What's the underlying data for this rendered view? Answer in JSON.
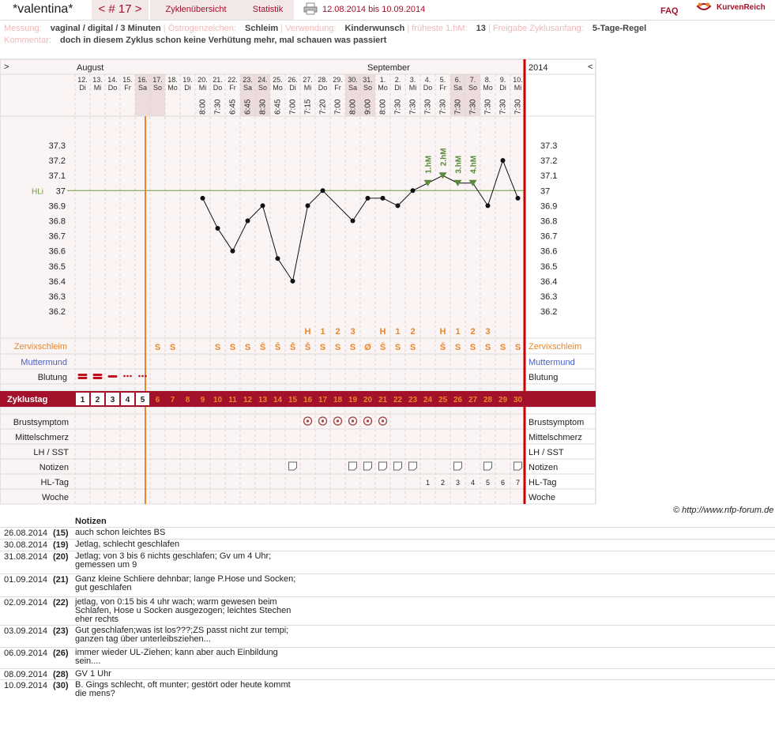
{
  "header": {
    "user": "*valentina*",
    "cycle": "< # 17 >",
    "overview": "Zyklenübersicht",
    "stats": "Statistik",
    "dates": "12.08.2014 bis 10.09.2014",
    "faq": "FAQ",
    "logo": "KurvenReich"
  },
  "info": {
    "messung_k": "Messung:",
    "messung_v": "vaginal / digital / 3 Minuten",
    "oestro_k": "Östrogenzeichen:",
    "oestro_v": "Schleim",
    "verw_k": "Verwendung:",
    "verw_v": "Kinderwunsch",
    "frueh_k": "früheste 1.hM:",
    "frueh_v": "13",
    "frei_k": "Freigabe Zyklusanfang:",
    "frei_v": "5-Tage-Regel",
    "komm_k": "Kommentar:",
    "komm_v": "doch in diesem Zyklus schon keine Verhütung mehr, mal schauen was passiert"
  },
  "chart_data": {
    "type": "line",
    "months": [
      "August",
      "September"
    ],
    "year": "2014",
    "nav_left": ">",
    "nav_right": "<",
    "dates": [
      "12.",
      "13.",
      "14.",
      "15.",
      "16.",
      "17.",
      "18.",
      "19.",
      "20.",
      "21.",
      "22.",
      "23.",
      "24.",
      "25.",
      "26.",
      "27.",
      "28.",
      "29.",
      "30.",
      "31.",
      "1.",
      "2.",
      "3.",
      "4.",
      "5.",
      "6.",
      "7.",
      "8.",
      "9.",
      "10."
    ],
    "weekdays": [
      "Di",
      "Mi",
      "Do",
      "Fr",
      "Sa",
      "So",
      "Mo",
      "Di",
      "Mi",
      "Do",
      "Fr",
      "Sa",
      "So",
      "Mo",
      "Di",
      "Mi",
      "Do",
      "Fr",
      "Sa",
      "So",
      "Mo",
      "Di",
      "Mi",
      "Do",
      "Fr",
      "Sa",
      "So",
      "Mo",
      "Di",
      "Mi"
    ],
    "times": [
      "",
      "",
      "",
      "",
      "",
      "",
      "",
      "",
      "8:00",
      "7:30",
      "6:45",
      "6:45",
      "8:30",
      "6:45",
      "7:00",
      "7:15",
      "7:20",
      "7:00",
      "8:00",
      "9:00",
      "8:00",
      "7:30",
      "7:30",
      "7:30",
      "7:30",
      "7:30",
      "7:30",
      "7:30",
      "7:30",
      "7:30"
    ],
    "temps": [
      null,
      null,
      null,
      null,
      null,
      null,
      null,
      null,
      36.95,
      36.75,
      36.6,
      36.8,
      36.9,
      36.55,
      36.4,
      36.9,
      37.0,
      null,
      36.8,
      36.95,
      36.95,
      36.9,
      37.0,
      37.05,
      37.1,
      37.05,
      37.05,
      36.9,
      37.2,
      36.95
    ],
    "yticks": [
      "37.3",
      "37.2",
      "37.1",
      "37",
      "36.9",
      "36.8",
      "36.7",
      "36.6",
      "36.5",
      "36.4",
      "36.3",
      "36.2"
    ],
    "ylim": [
      36.15,
      37.35
    ],
    "hl_label": "HLi",
    "hl_value": 37.0,
    "hm_labels": [
      "1.hM",
      "2.hM",
      "3.hM",
      "4.hM"
    ],
    "peak_marks": [
      "H",
      "1",
      "2",
      "3",
      "H",
      "1",
      "2",
      "H",
      "1",
      "2",
      "3"
    ],
    "cervix": [
      "",
      "",
      "",
      "",
      "",
      "S",
      "S",
      "",
      "",
      "S",
      "S",
      "S",
      "S̄",
      "S̄",
      "S̄",
      "S̄",
      "S",
      "S",
      "S",
      "Ø",
      "S̄",
      "S",
      "S",
      "",
      "S̄",
      "S",
      "S",
      "S",
      "S",
      "S"
    ],
    "rows": {
      "zervix": "Zervixschleim",
      "mumu": "Muttermund",
      "blut": "Blutung",
      "zt": "Zyklustag",
      "brust": "Brustsymptom",
      "mittel": "Mittelschmerz",
      "lh": "LH / SST",
      "notiz": "Notizen",
      "hltag": "HL-Tag",
      "woche": "Woche"
    },
    "cycle_days": [
      "1",
      "2",
      "3",
      "4",
      "5",
      "6",
      "7",
      "8",
      "9",
      "10",
      "11",
      "12",
      "13",
      "14",
      "15",
      "16",
      "17",
      "18",
      "19",
      "20",
      "21",
      "22",
      "23",
      "24",
      "25",
      "26",
      "27",
      "28",
      "29",
      "30"
    ],
    "hl_days": [
      "1",
      "2",
      "3",
      "4",
      "5",
      "6",
      "7"
    ]
  },
  "notes": {
    "title": "Notizen",
    "items": [
      {
        "date": "26.08.2014",
        "day": "(15)",
        "text": "auch schon leichtes BS"
      },
      {
        "date": "30.08.2014",
        "day": "(19)",
        "text": "Jetlag, schlecht geschlafen"
      },
      {
        "date": "31.08.2014",
        "day": "(20)",
        "text": "Jetlag; von 3 bis 6 nichts geschlafen; Gv um 4 Uhr; gemessen um 9"
      },
      {
        "date": "01.09.2014",
        "day": "(21)",
        "text": "Ganz kleine Schliere dehnbar; lange P.Hose und Socken; gut geschlafen"
      },
      {
        "date": "02.09.2014",
        "day": "(22)",
        "text": "jetlag, von 0:15 bis 4 uhr wach; warm gewesen beim Schlafen, Hose u Socken ausgezogen; leichtes Stechen eher rechts"
      },
      {
        "date": "03.09.2014",
        "day": "(23)",
        "text": "Gut geschlafen;was ist los???;ZS passt nicht zur tempi; ganzen tag über unterleibsziehen..."
      },
      {
        "date": "06.09.2014",
        "day": "(26)",
        "text": "immer wieder UL-Ziehen; kann aber auch Einbildung sein...."
      },
      {
        "date": "08.09.2014",
        "day": "(28)",
        "text": "GV 1 Uhr"
      },
      {
        "date": "10.09.2014",
        "day": "(30)",
        "text": "B. Gings schlecht, oft munter; gestört oder heute kommt die mens?"
      }
    ]
  },
  "copyright": "© http://www.nfp-forum.de",
  "colors": {
    "accent": "#a3122a",
    "orange": "#e8862a",
    "hm_green": "#5a8a3a",
    "hl_line": "#6a9a40",
    "blue": "#4a5fc1"
  }
}
